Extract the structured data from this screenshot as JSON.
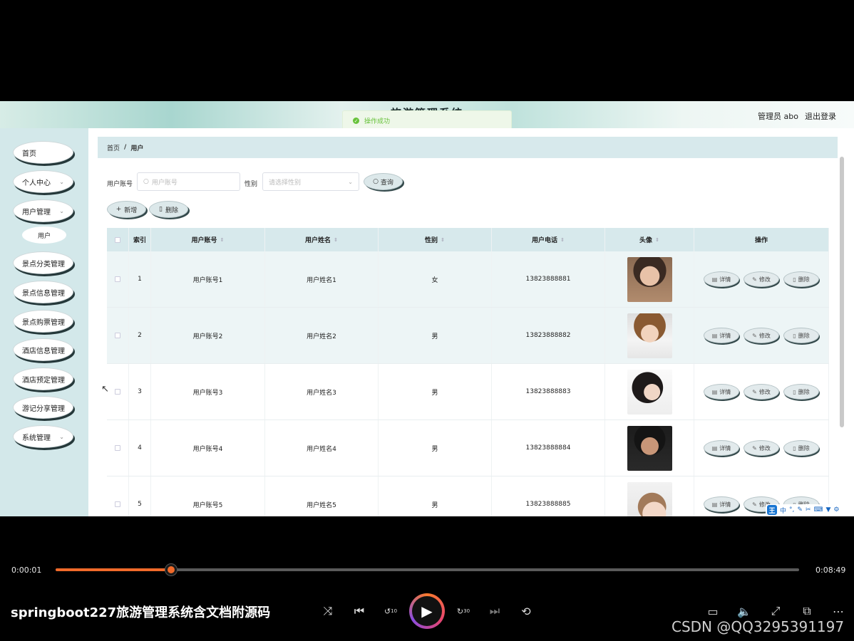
{
  "app": {
    "title": "旅游管理系统",
    "admin_label": "管理员 abo",
    "logout_label": "退出登录",
    "toast": "操作成功"
  },
  "sidebar": {
    "items": [
      {
        "label": "首页",
        "chevron": false
      },
      {
        "label": "个人中心",
        "chevron": true
      },
      {
        "label": "用户管理",
        "chevron": true
      },
      {
        "label": "景点分类管理",
        "chevron": false
      },
      {
        "label": "景点信息管理",
        "chevron": false
      },
      {
        "label": "景点购票管理",
        "chevron": false
      },
      {
        "label": "酒店信息管理",
        "chevron": false
      },
      {
        "label": "酒店预定管理",
        "chevron": false
      },
      {
        "label": "游记分享管理",
        "chevron": false
      },
      {
        "label": "系统管理",
        "chevron": true
      }
    ],
    "submenu_label": "用户"
  },
  "breadcrumb": {
    "home": "首页",
    "separator": "/",
    "current": "用户"
  },
  "search": {
    "account_label": "用户账号",
    "account_placeholder": "用户账号",
    "gender_label": "性别",
    "gender_placeholder": "请选择性别",
    "query_button": "查询",
    "add_button": "新增",
    "delete_button": "删除"
  },
  "table": {
    "headers": {
      "index": "索引",
      "account": "用户账号",
      "name": "用户姓名",
      "gender": "性别",
      "phone": "用户电话",
      "avatar": "头像",
      "actions": "操作"
    },
    "action_labels": {
      "detail": "详情",
      "edit": "修改",
      "delete": "删除"
    },
    "rows": [
      {
        "index": "1",
        "account": "用户账号1",
        "name": "用户姓名1",
        "gender": "女",
        "phone": "13823888881"
      },
      {
        "index": "2",
        "account": "用户账号2",
        "name": "用户姓名2",
        "gender": "男",
        "phone": "13823888882"
      },
      {
        "index": "3",
        "account": "用户账号3",
        "name": "用户姓名3",
        "gender": "男",
        "phone": "13823888883"
      },
      {
        "index": "4",
        "account": "用户账号4",
        "name": "用户姓名4",
        "gender": "男",
        "phone": "13823888884"
      },
      {
        "index": "5",
        "account": "用户账号5",
        "name": "用户姓名5",
        "gender": "男",
        "phone": "13823888885"
      }
    ]
  },
  "ime": {
    "logo": "王",
    "mode": "中"
  },
  "player": {
    "current_time": "0:00:01",
    "total_time": "0:08:49",
    "progress": 0.155,
    "video_title": "springboot227旅游管理系统含文档附源码",
    "skip_back": "10",
    "skip_forward": "30",
    "watermark": "CSDN @QQ3295391197",
    "accent": "#f06a2a"
  }
}
